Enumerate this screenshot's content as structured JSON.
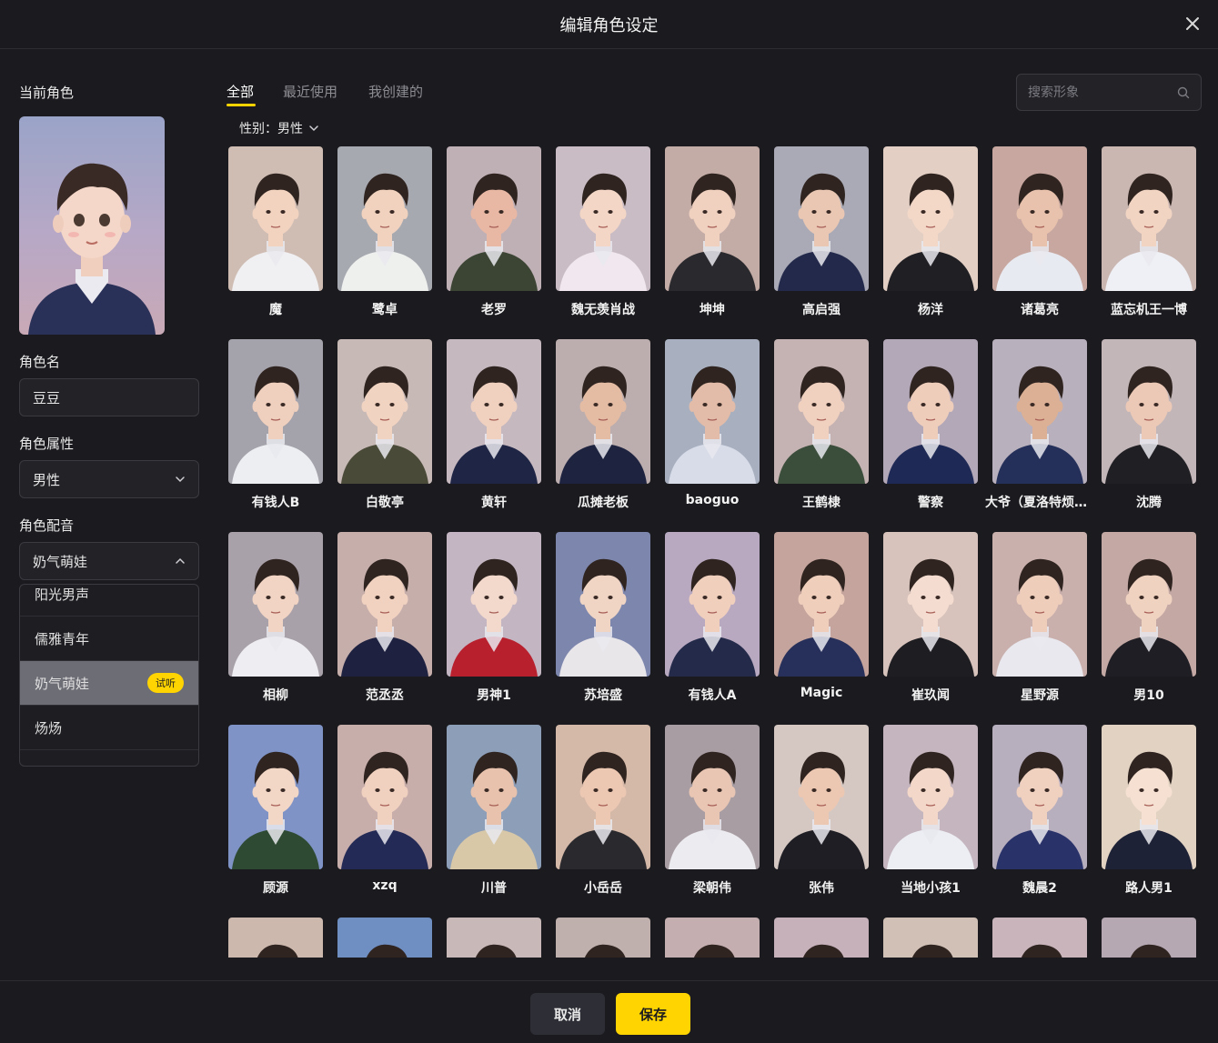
{
  "header": {
    "title": "编辑角色设定",
    "close_icon": "close-icon"
  },
  "left": {
    "current_role_label": "当前角色",
    "role_name_label": "角色名",
    "role_name_value": "豆豆",
    "role_attr_label": "角色属性",
    "role_attr_value": "男性",
    "role_voice_label": "角色配音",
    "role_voice_value": "奶气萌娃",
    "voice_options": [
      {
        "label": "阳光男声"
      },
      {
        "label": "儒雅青年"
      },
      {
        "label": "奶气萌娃",
        "badge": "试听",
        "selected": true
      },
      {
        "label": "炀炀"
      }
    ]
  },
  "tabs": [
    {
      "label": "全部",
      "active": true
    },
    {
      "label": "最近使用"
    },
    {
      "label": "我创建的"
    }
  ],
  "search": {
    "placeholder": "搜索形象"
  },
  "filter": {
    "label": "性别：男性"
  },
  "characters": [
    {
      "name": "魔",
      "bg": "#cfbdb4",
      "shirt": "#f0f0f2",
      "skin": "#f2d3c0"
    },
    {
      "name": "鹭卓",
      "bg": "#a7a9b0",
      "shirt": "#eef0ee",
      "skin": "#f0d2be"
    },
    {
      "name": "老罗",
      "bg": "#bfb0b6",
      "shirt": "#3c4534",
      "skin": "#e8b8a4"
    },
    {
      "name": "魏无羡肖战",
      "bg": "#c9bcc4",
      "shirt": "#f0e8ee",
      "skin": "#f3d6c6"
    },
    {
      "name": "坤坤",
      "bg": "#c4aca6",
      "shirt": "#2a2a2e",
      "skin": "#f0d0bf"
    },
    {
      "name": "高启强",
      "bg": "#a9aab6",
      "shirt": "#22294a",
      "skin": "#e9c7b3"
    },
    {
      "name": "杨洋",
      "bg": "#e3cfc4",
      "shirt": "#1f1f24",
      "skin": "#f3d8c8"
    },
    {
      "name": "诸葛亮",
      "bg": "#c7a79f",
      "shirt": "#e8eaf2",
      "skin": "#e8c2ad"
    },
    {
      "name": "蓝忘机王一博",
      "bg": "#cbb7b2",
      "shirt": "#eef0f5",
      "skin": "#f2d4c2"
    },
    {
      "name": "有钱人B",
      "bg": "#a4a2ab",
      "shirt": "#eceef2",
      "skin": "#efcfbd"
    },
    {
      "name": "白敬亭",
      "bg": "#c7b9b6",
      "shirt": "#4a4a38",
      "skin": "#f1d3c1"
    },
    {
      "name": "黄轩",
      "bg": "#c5b8bf",
      "shirt": "#1f2544",
      "skin": "#f0d1c0"
    },
    {
      "name": "瓜摊老板",
      "bg": "#bcaeae",
      "shirt": "#1e2440",
      "skin": "#e4bba3"
    },
    {
      "name": "baoguo",
      "bg": "#a8b0c0",
      "shirt": "#d8dce8",
      "skin": "#e2bca8"
    },
    {
      "name": "王鹤棣",
      "bg": "#c5b2b2",
      "shirt": "#3b4d3b",
      "skin": "#f0d0bf"
    },
    {
      "name": "警察",
      "bg": "#b3a8b8",
      "shirt": "#1e2a55",
      "skin": "#efcdbb"
    },
    {
      "name": "大爷（夏洛特烦恼）",
      "bg": "#b8b0bc",
      "shirt": "#25305a",
      "skin": "#dcb095"
    },
    {
      "name": "沈腾",
      "bg": "#c3b6b8",
      "shirt": "#1f1f24",
      "skin": "#ebc9b6"
    },
    {
      "name": "相柳",
      "bg": "#a9a1a9",
      "shirt": "#eeeef2",
      "skin": "#f1d4c3"
    },
    {
      "name": "范丞丞",
      "bg": "#c6aeab",
      "shirt": "#1e2240",
      "skin": "#f1d2c0"
    },
    {
      "name": "男神1",
      "bg": "#c4b5c2",
      "shirt": "#b8202e",
      "skin": "#f3d9cc"
    },
    {
      "name": "苏培盛",
      "bg": "#7d86ad",
      "shirt": "#e9e6ea",
      "skin": "#f0d4c4"
    },
    {
      "name": "有钱人A",
      "bg": "#b8a9c0",
      "shirt": "#232a4a",
      "skin": "#f0cfbd"
    },
    {
      "name": "Magic",
      "bg": "#c4a49c",
      "shirt": "#27305a",
      "skin": "#efcfbc"
    },
    {
      "name": "崔玖闻",
      "bg": "#d7c3bb",
      "shirt": "#1d1d22",
      "skin": "#f4dcd0"
    },
    {
      "name": "星野源",
      "bg": "#c9b0ad",
      "shirt": "#e8e8ee",
      "skin": "#eecdbb"
    },
    {
      "name": "男10",
      "bg": "#c3a8a4",
      "shirt": "#1e1e24",
      "skin": "#f0d2c1"
    },
    {
      "name": "顾源",
      "bg": "#7f93c7",
      "shirt": "#2e4a32",
      "skin": "#f2d6c6"
    },
    {
      "name": "xzq",
      "bg": "#c8aeab",
      "shirt": "#222a55",
      "skin": "#f0d0bf"
    },
    {
      "name": "川普",
      "bg": "#8d9fb8",
      "shirt": "#d8c8a8",
      "skin": "#e8c2ad"
    },
    {
      "name": "小岳岳",
      "bg": "#d4b8a8",
      "shirt": "#2a2a2e",
      "skin": "#ecc7b2"
    },
    {
      "name": "梁朝伟",
      "bg": "#a89da3",
      "shirt": "#ecebef",
      "skin": "#e9c6b3"
    },
    {
      "name": "张伟",
      "bg": "#d5c8c2",
      "shirt": "#1e1e24",
      "skin": "#ecc7b2"
    },
    {
      "name": "当地小孩1",
      "bg": "#c5b5be",
      "shirt": "#eceef4",
      "skin": "#f3d8c9"
    },
    {
      "name": "魏晨2",
      "bg": "#b7aebe",
      "shirt": "#2a326a",
      "skin": "#f0d0bf"
    },
    {
      "name": "路人男1",
      "bg": "#e2d2c2",
      "shirt": "#1e2236",
      "skin": "#f5e0d2"
    },
    {
      "name": "",
      "bg": "#cdb8ae",
      "shirt": "#eee",
      "skin": "#f0d0bf"
    },
    {
      "name": "",
      "bg": "#6f8ec2",
      "shirt": "#eee",
      "skin": "#f0d0bf"
    },
    {
      "name": "",
      "bg": "#c8b8b8",
      "shirt": "#eee",
      "skin": "#f0d0bf"
    },
    {
      "name": "",
      "bg": "#bfb0ae",
      "shirt": "#eee",
      "skin": "#f0d0bf"
    },
    {
      "name": "",
      "bg": "#c4aeb0",
      "shirt": "#eee",
      "skin": "#f0d0bf"
    },
    {
      "name": "",
      "bg": "#c6b0ba",
      "shirt": "#eee",
      "skin": "#f0d0bf"
    },
    {
      "name": "",
      "bg": "#d1c0b6",
      "shirt": "#eee",
      "skin": "#f0d0bf"
    },
    {
      "name": "",
      "bg": "#c9b4bc",
      "shirt": "#eee",
      "skin": "#f0d0bf"
    },
    {
      "name": "",
      "bg": "#b6a8b2",
      "shirt": "#eee",
      "skin": "#f0d0bf"
    }
  ],
  "footer": {
    "cancel_label": "取消",
    "save_label": "保存"
  },
  "colors": {
    "accent": "#ffd400",
    "background": "#1b1b1f"
  }
}
